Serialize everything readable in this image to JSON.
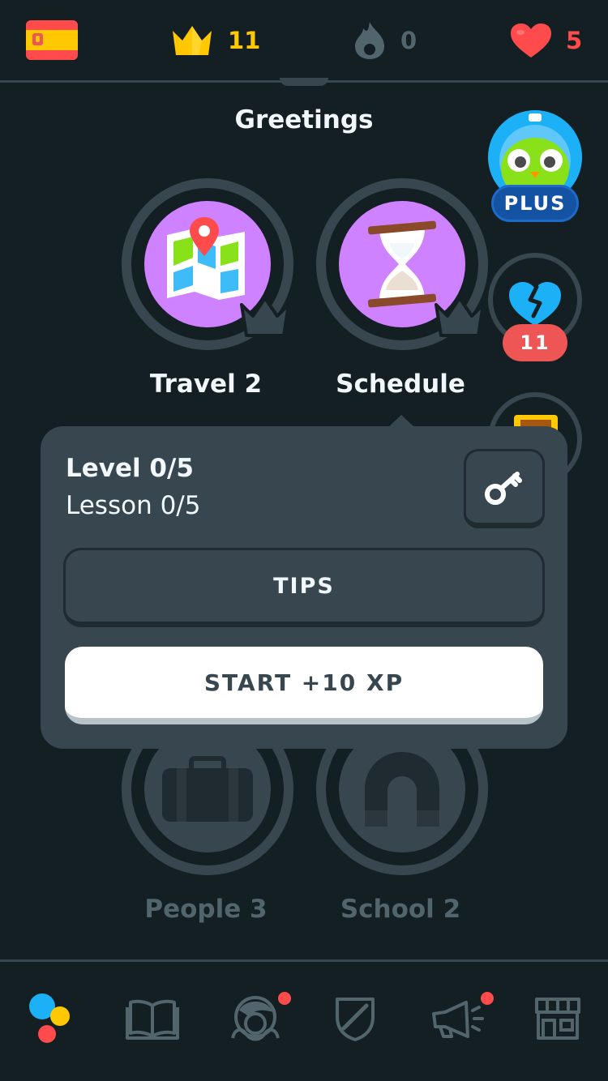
{
  "topbar": {
    "course_flag": "spain-flag-icon",
    "crowns": "11",
    "streak": "0",
    "hearts": "5"
  },
  "section": {
    "title": "Greetings"
  },
  "skills": [
    {
      "name": "Travel 2",
      "icon": "map-pin-icon",
      "state": "active"
    },
    {
      "name": "Schedule",
      "icon": "hourglass-icon",
      "state": "active"
    },
    {
      "name": "People 3",
      "icon": "suitcase-icon",
      "state": "locked"
    },
    {
      "name": "School 2",
      "icon": "magnet-icon",
      "state": "locked"
    }
  ],
  "rail": {
    "plus_label": "PLUS",
    "heart_repair_count": "11"
  },
  "popover": {
    "level": "Level 0/5",
    "lesson": "Lesson 0/5",
    "tips_label": "TIPS",
    "start_label": "START +10 XP"
  },
  "nav": [
    {
      "name": "learn",
      "icon": "learn-dots-icon",
      "notification": false
    },
    {
      "name": "stories",
      "icon": "book-icon",
      "notification": false
    },
    {
      "name": "profile",
      "icon": "avatar-icon",
      "notification": true
    },
    {
      "name": "leagues",
      "icon": "shield-icon",
      "notification": false
    },
    {
      "name": "news",
      "icon": "megaphone-icon",
      "notification": true
    },
    {
      "name": "shop",
      "icon": "shop-icon",
      "notification": false
    }
  ],
  "colors": {
    "background": "#141f23",
    "surface": "#37464f",
    "accent_purple": "#ce82ff",
    "crown_gold": "#ffc800",
    "heart_red": "#ff4b4b",
    "plus_blue": "#1453a3"
  }
}
